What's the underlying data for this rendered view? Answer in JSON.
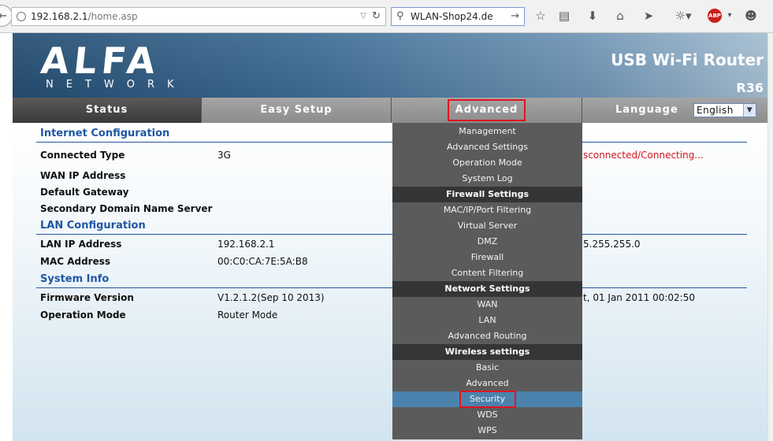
{
  "browser": {
    "url_host": "192.168.2.1",
    "url_path": "/home.asp",
    "search_value": "WLAN-Shop24.de",
    "toolbar_icons": [
      "star-icon",
      "reading-list-icon",
      "download-icon",
      "home-icon",
      "send-icon",
      "extension-icon",
      "adblock-plus-icon",
      "smiley-icon"
    ],
    "abp_label": "ABP"
  },
  "header": {
    "logo_main": "ALFA",
    "logo_sub": "NETWORK",
    "product_title": "USB Wi-Fi Router",
    "model": "R36"
  },
  "nav": {
    "tabs": [
      {
        "label": "Status"
      },
      {
        "label": "Easy Setup"
      },
      {
        "label": "Advanced"
      },
      {
        "label": "Language"
      }
    ],
    "language_value": "English"
  },
  "content": {
    "internet": {
      "title": "Internet Configuration",
      "connected_type_label": "Connected Type",
      "connected_type_value": "3G",
      "connected_status": "sconnected/Connecting...",
      "wan_ip_label": "WAN IP Address",
      "gateway_label": "Default Gateway",
      "dns2_label": "Secondary Domain Name Server"
    },
    "lan": {
      "title": "LAN Configuration",
      "lan_ip_label": "LAN IP Address",
      "lan_ip_value": "192.168.2.1",
      "subnet_value_partial": "5.255.255.0",
      "mac_label": "MAC Address",
      "mac_value": "00:C0:CA:7E:5A:B8"
    },
    "system": {
      "title": "System Info",
      "fw_label": "Firmware Version",
      "fw_value": "V1.2.1.2(Sep 10 2013)",
      "time_partial": "t, 01 Jan 2011 00:02:50",
      "mode_label": "Operation Mode",
      "mode_value": "Router Mode"
    }
  },
  "advanced_menu": {
    "items": [
      {
        "label": "Management",
        "type": "item"
      },
      {
        "label": "Advanced Settings",
        "type": "item"
      },
      {
        "label": "Operation Mode",
        "type": "item"
      },
      {
        "label": "System Log",
        "type": "item"
      },
      {
        "label": "Firewall Settings",
        "type": "header"
      },
      {
        "label": "MAC/IP/Port Filtering",
        "type": "item"
      },
      {
        "label": "Virtual Server",
        "type": "item"
      },
      {
        "label": "DMZ",
        "type": "item"
      },
      {
        "label": "Firewall",
        "type": "item"
      },
      {
        "label": "Content Filtering",
        "type": "item"
      },
      {
        "label": "Network Settings",
        "type": "header"
      },
      {
        "label": "WAN",
        "type": "item"
      },
      {
        "label": "LAN",
        "type": "item"
      },
      {
        "label": "Advanced Routing",
        "type": "item"
      },
      {
        "label": "Wireless settings",
        "type": "header"
      },
      {
        "label": "Basic",
        "type": "item"
      },
      {
        "label": "Advanced",
        "type": "item"
      },
      {
        "label": "Security",
        "type": "selected"
      },
      {
        "label": "WDS",
        "type": "item"
      },
      {
        "label": "WPS",
        "type": "item"
      }
    ]
  }
}
